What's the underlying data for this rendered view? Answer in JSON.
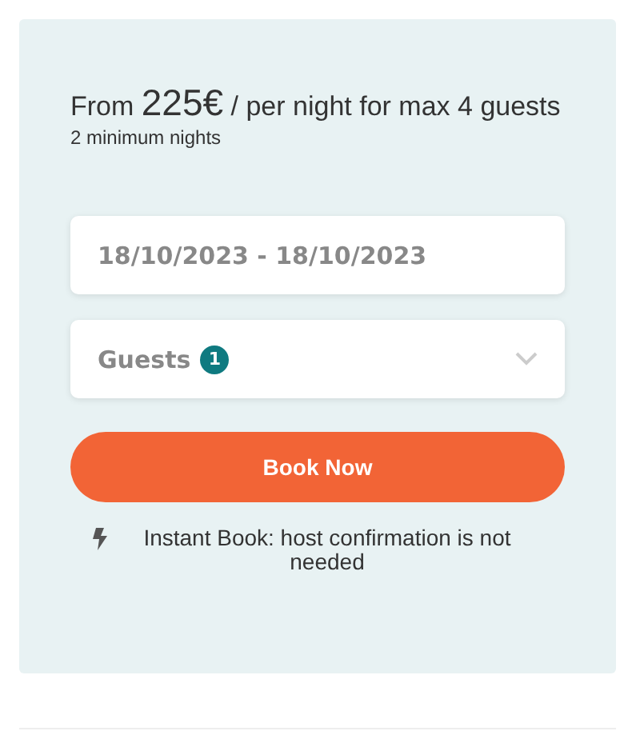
{
  "price": {
    "prefix": "From",
    "amount": "225€",
    "suffix": "/ per night for max 4 guests"
  },
  "minimum": "2 minimum nights",
  "dates": {
    "value": "18/10/2023 - 18/10/2023"
  },
  "guests": {
    "label": "Guests",
    "count": "1"
  },
  "button": "Book Now",
  "note": "Instant Book: host confirmation is not needed"
}
